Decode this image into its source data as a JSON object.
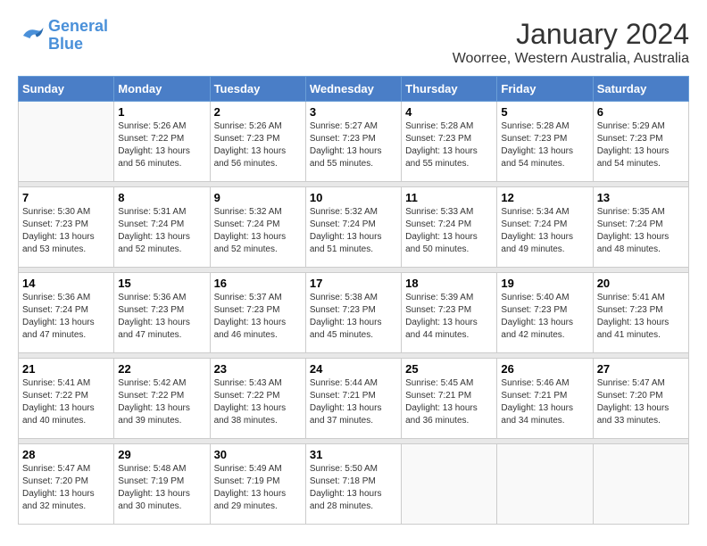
{
  "logo": {
    "line1": "General",
    "line2": "Blue"
  },
  "title": "January 2024",
  "subtitle": "Woorree, Western Australia, Australia",
  "days_of_week": [
    "Sunday",
    "Monday",
    "Tuesday",
    "Wednesday",
    "Thursday",
    "Friday",
    "Saturday"
  ],
  "weeks": [
    [
      {
        "day": "",
        "sunrise": "",
        "sunset": "",
        "daylight": ""
      },
      {
        "day": "1",
        "sunrise": "Sunrise: 5:26 AM",
        "sunset": "Sunset: 7:22 PM",
        "daylight": "Daylight: 13 hours and 56 minutes."
      },
      {
        "day": "2",
        "sunrise": "Sunrise: 5:26 AM",
        "sunset": "Sunset: 7:23 PM",
        "daylight": "Daylight: 13 hours and 56 minutes."
      },
      {
        "day": "3",
        "sunrise": "Sunrise: 5:27 AM",
        "sunset": "Sunset: 7:23 PM",
        "daylight": "Daylight: 13 hours and 55 minutes."
      },
      {
        "day": "4",
        "sunrise": "Sunrise: 5:28 AM",
        "sunset": "Sunset: 7:23 PM",
        "daylight": "Daylight: 13 hours and 55 minutes."
      },
      {
        "day": "5",
        "sunrise": "Sunrise: 5:28 AM",
        "sunset": "Sunset: 7:23 PM",
        "daylight": "Daylight: 13 hours and 54 minutes."
      },
      {
        "day": "6",
        "sunrise": "Sunrise: 5:29 AM",
        "sunset": "Sunset: 7:23 PM",
        "daylight": "Daylight: 13 hours and 54 minutes."
      }
    ],
    [
      {
        "day": "7",
        "sunrise": "Sunrise: 5:30 AM",
        "sunset": "Sunset: 7:23 PM",
        "daylight": "Daylight: 13 hours and 53 minutes."
      },
      {
        "day": "8",
        "sunrise": "Sunrise: 5:31 AM",
        "sunset": "Sunset: 7:24 PM",
        "daylight": "Daylight: 13 hours and 52 minutes."
      },
      {
        "day": "9",
        "sunrise": "Sunrise: 5:32 AM",
        "sunset": "Sunset: 7:24 PM",
        "daylight": "Daylight: 13 hours and 52 minutes."
      },
      {
        "day": "10",
        "sunrise": "Sunrise: 5:32 AM",
        "sunset": "Sunset: 7:24 PM",
        "daylight": "Daylight: 13 hours and 51 minutes."
      },
      {
        "day": "11",
        "sunrise": "Sunrise: 5:33 AM",
        "sunset": "Sunset: 7:24 PM",
        "daylight": "Daylight: 13 hours and 50 minutes."
      },
      {
        "day": "12",
        "sunrise": "Sunrise: 5:34 AM",
        "sunset": "Sunset: 7:24 PM",
        "daylight": "Daylight: 13 hours and 49 minutes."
      },
      {
        "day": "13",
        "sunrise": "Sunrise: 5:35 AM",
        "sunset": "Sunset: 7:24 PM",
        "daylight": "Daylight: 13 hours and 48 minutes."
      }
    ],
    [
      {
        "day": "14",
        "sunrise": "Sunrise: 5:36 AM",
        "sunset": "Sunset: 7:24 PM",
        "daylight": "Daylight: 13 hours and 47 minutes."
      },
      {
        "day": "15",
        "sunrise": "Sunrise: 5:36 AM",
        "sunset": "Sunset: 7:23 PM",
        "daylight": "Daylight: 13 hours and 47 minutes."
      },
      {
        "day": "16",
        "sunrise": "Sunrise: 5:37 AM",
        "sunset": "Sunset: 7:23 PM",
        "daylight": "Daylight: 13 hours and 46 minutes."
      },
      {
        "day": "17",
        "sunrise": "Sunrise: 5:38 AM",
        "sunset": "Sunset: 7:23 PM",
        "daylight": "Daylight: 13 hours and 45 minutes."
      },
      {
        "day": "18",
        "sunrise": "Sunrise: 5:39 AM",
        "sunset": "Sunset: 7:23 PM",
        "daylight": "Daylight: 13 hours and 44 minutes."
      },
      {
        "day": "19",
        "sunrise": "Sunrise: 5:40 AM",
        "sunset": "Sunset: 7:23 PM",
        "daylight": "Daylight: 13 hours and 42 minutes."
      },
      {
        "day": "20",
        "sunrise": "Sunrise: 5:41 AM",
        "sunset": "Sunset: 7:23 PM",
        "daylight": "Daylight: 13 hours and 41 minutes."
      }
    ],
    [
      {
        "day": "21",
        "sunrise": "Sunrise: 5:41 AM",
        "sunset": "Sunset: 7:22 PM",
        "daylight": "Daylight: 13 hours and 40 minutes."
      },
      {
        "day": "22",
        "sunrise": "Sunrise: 5:42 AM",
        "sunset": "Sunset: 7:22 PM",
        "daylight": "Daylight: 13 hours and 39 minutes."
      },
      {
        "day": "23",
        "sunrise": "Sunrise: 5:43 AM",
        "sunset": "Sunset: 7:22 PM",
        "daylight": "Daylight: 13 hours and 38 minutes."
      },
      {
        "day": "24",
        "sunrise": "Sunrise: 5:44 AM",
        "sunset": "Sunset: 7:21 PM",
        "daylight": "Daylight: 13 hours and 37 minutes."
      },
      {
        "day": "25",
        "sunrise": "Sunrise: 5:45 AM",
        "sunset": "Sunset: 7:21 PM",
        "daylight": "Daylight: 13 hours and 36 minutes."
      },
      {
        "day": "26",
        "sunrise": "Sunrise: 5:46 AM",
        "sunset": "Sunset: 7:21 PM",
        "daylight": "Daylight: 13 hours and 34 minutes."
      },
      {
        "day": "27",
        "sunrise": "Sunrise: 5:47 AM",
        "sunset": "Sunset: 7:20 PM",
        "daylight": "Daylight: 13 hours and 33 minutes."
      }
    ],
    [
      {
        "day": "28",
        "sunrise": "Sunrise: 5:47 AM",
        "sunset": "Sunset: 7:20 PM",
        "daylight": "Daylight: 13 hours and 32 minutes."
      },
      {
        "day": "29",
        "sunrise": "Sunrise: 5:48 AM",
        "sunset": "Sunset: 7:19 PM",
        "daylight": "Daylight: 13 hours and 30 minutes."
      },
      {
        "day": "30",
        "sunrise": "Sunrise: 5:49 AM",
        "sunset": "Sunset: 7:19 PM",
        "daylight": "Daylight: 13 hours and 29 minutes."
      },
      {
        "day": "31",
        "sunrise": "Sunrise: 5:50 AM",
        "sunset": "Sunset: 7:18 PM",
        "daylight": "Daylight: 13 hours and 28 minutes."
      },
      {
        "day": "",
        "sunrise": "",
        "sunset": "",
        "daylight": ""
      },
      {
        "day": "",
        "sunrise": "",
        "sunset": "",
        "daylight": ""
      },
      {
        "day": "",
        "sunrise": "",
        "sunset": "",
        "daylight": ""
      }
    ]
  ]
}
